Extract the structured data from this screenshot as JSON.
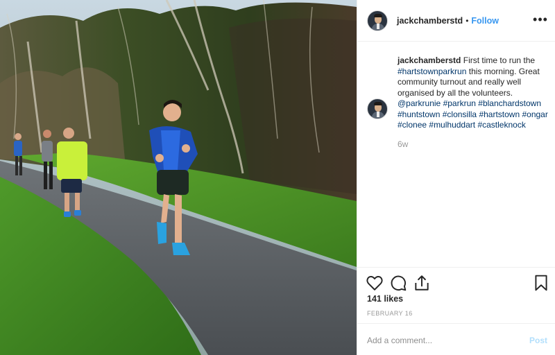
{
  "post": {
    "image_alt": "",
    "header": {
      "username": "jackchamberstd",
      "separator": "•",
      "follow_label": "Follow",
      "more_label": "•••"
    },
    "caption": {
      "username": "jackchamberstd",
      "text_1": "First time to run the",
      "tag_1": "#hartstownparkrun",
      "text_2": "this morning. Great community turnout and really well organised by all the volunteers.",
      "tag_2": "@parkrunie",
      "tag_3": "#parkrun",
      "tag_4": "#blanchardstown",
      "tag_5": "#huntstown",
      "tag_6": "#clonsilla",
      "tag_7": "#hartstown",
      "tag_8": "#ongar",
      "tag_9": "#clonee",
      "tag_10": "#mulhuddart",
      "tag_11": "#castleknock",
      "time_ago": "6w"
    },
    "likes": "141 likes",
    "date": "FEBRUARY 16",
    "comment_placeholder": "Add a comment...",
    "post_label": "Post"
  },
  "colors": {
    "link": "#3897f0",
    "hashtag": "#003569",
    "muted": "#999999",
    "post_disabled": "#b2dffc"
  }
}
